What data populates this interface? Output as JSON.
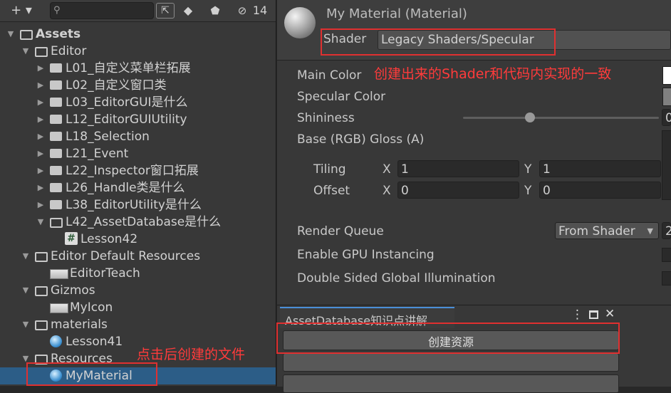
{
  "project": {
    "toolbar": {
      "add_label": "+ ▾",
      "search_placeholder": "",
      "hidden_count": "14"
    },
    "tree": [
      {
        "label": "Assets",
        "kind": "folder-open",
        "expanded": true
      },
      {
        "label": "Editor",
        "kind": "folder-open",
        "expanded": true
      },
      {
        "label": "L01_自定义菜单栏拓展",
        "kind": "folder"
      },
      {
        "label": "L02_自定义窗口类",
        "kind": "folder"
      },
      {
        "label": "L03_EditorGUI是什么",
        "kind": "folder"
      },
      {
        "label": "L12_EditorGUIUtility",
        "kind": "folder"
      },
      {
        "label": "L18_Selection",
        "kind": "folder"
      },
      {
        "label": "L21_Event",
        "kind": "folder"
      },
      {
        "label": "L22_Inspector窗口拓展",
        "kind": "folder"
      },
      {
        "label": "L26_Handle类是什么",
        "kind": "folder"
      },
      {
        "label": "L38_EditorUtility是什么",
        "kind": "folder"
      },
      {
        "label": "L42_AssetDatabase是什么",
        "kind": "folder-open",
        "expanded": true
      },
      {
        "label": "Lesson42",
        "kind": "script"
      },
      {
        "label": "Editor Default Resources",
        "kind": "folder-open",
        "expanded": true
      },
      {
        "label": "EditorTeach",
        "kind": "texture"
      },
      {
        "label": "Gizmos",
        "kind": "folder-open",
        "expanded": true
      },
      {
        "label": "MyIcon",
        "kind": "texture"
      },
      {
        "label": "materials",
        "kind": "folder-open",
        "expanded": true
      },
      {
        "label": "Lesson41",
        "kind": "material"
      },
      {
        "label": "Resources",
        "kind": "folder-open",
        "expanded": true
      },
      {
        "label": "MyMaterial",
        "kind": "material",
        "selected": true
      }
    ],
    "annotation": "点击后创建的文件"
  },
  "inspector": {
    "title": "My Material (Material)",
    "shader_label": "Shader",
    "shader_value": "Legacy Shaders/Specular",
    "annotation": "创建出来的Shader和代码内实现的一致",
    "props": {
      "main_color": "Main Color",
      "specular_color": "Specular Color",
      "shininess": "Shininess",
      "shininess_value": "0",
      "base_gloss": "Base (RGB) Gloss (A)",
      "tiling": "Tiling",
      "offset": "Offset",
      "x_label": "X",
      "y_label": "Y",
      "tiling_x": "1",
      "tiling_y": "1",
      "offset_x": "0",
      "offset_y": "0"
    },
    "render_queue_label": "Render Queue",
    "render_queue_value": "From Shader",
    "render_queue_number": "2",
    "gpu_instancing": "Enable GPU Instancing",
    "double_sided_gi": "Double Sided Global Illumination"
  },
  "window": {
    "tab_title": "AssetDatabase知识点讲解",
    "create_button": "创建资源"
  },
  "colors": {
    "accent": "#2c5d87",
    "annotation": "#ff3b3b"
  }
}
